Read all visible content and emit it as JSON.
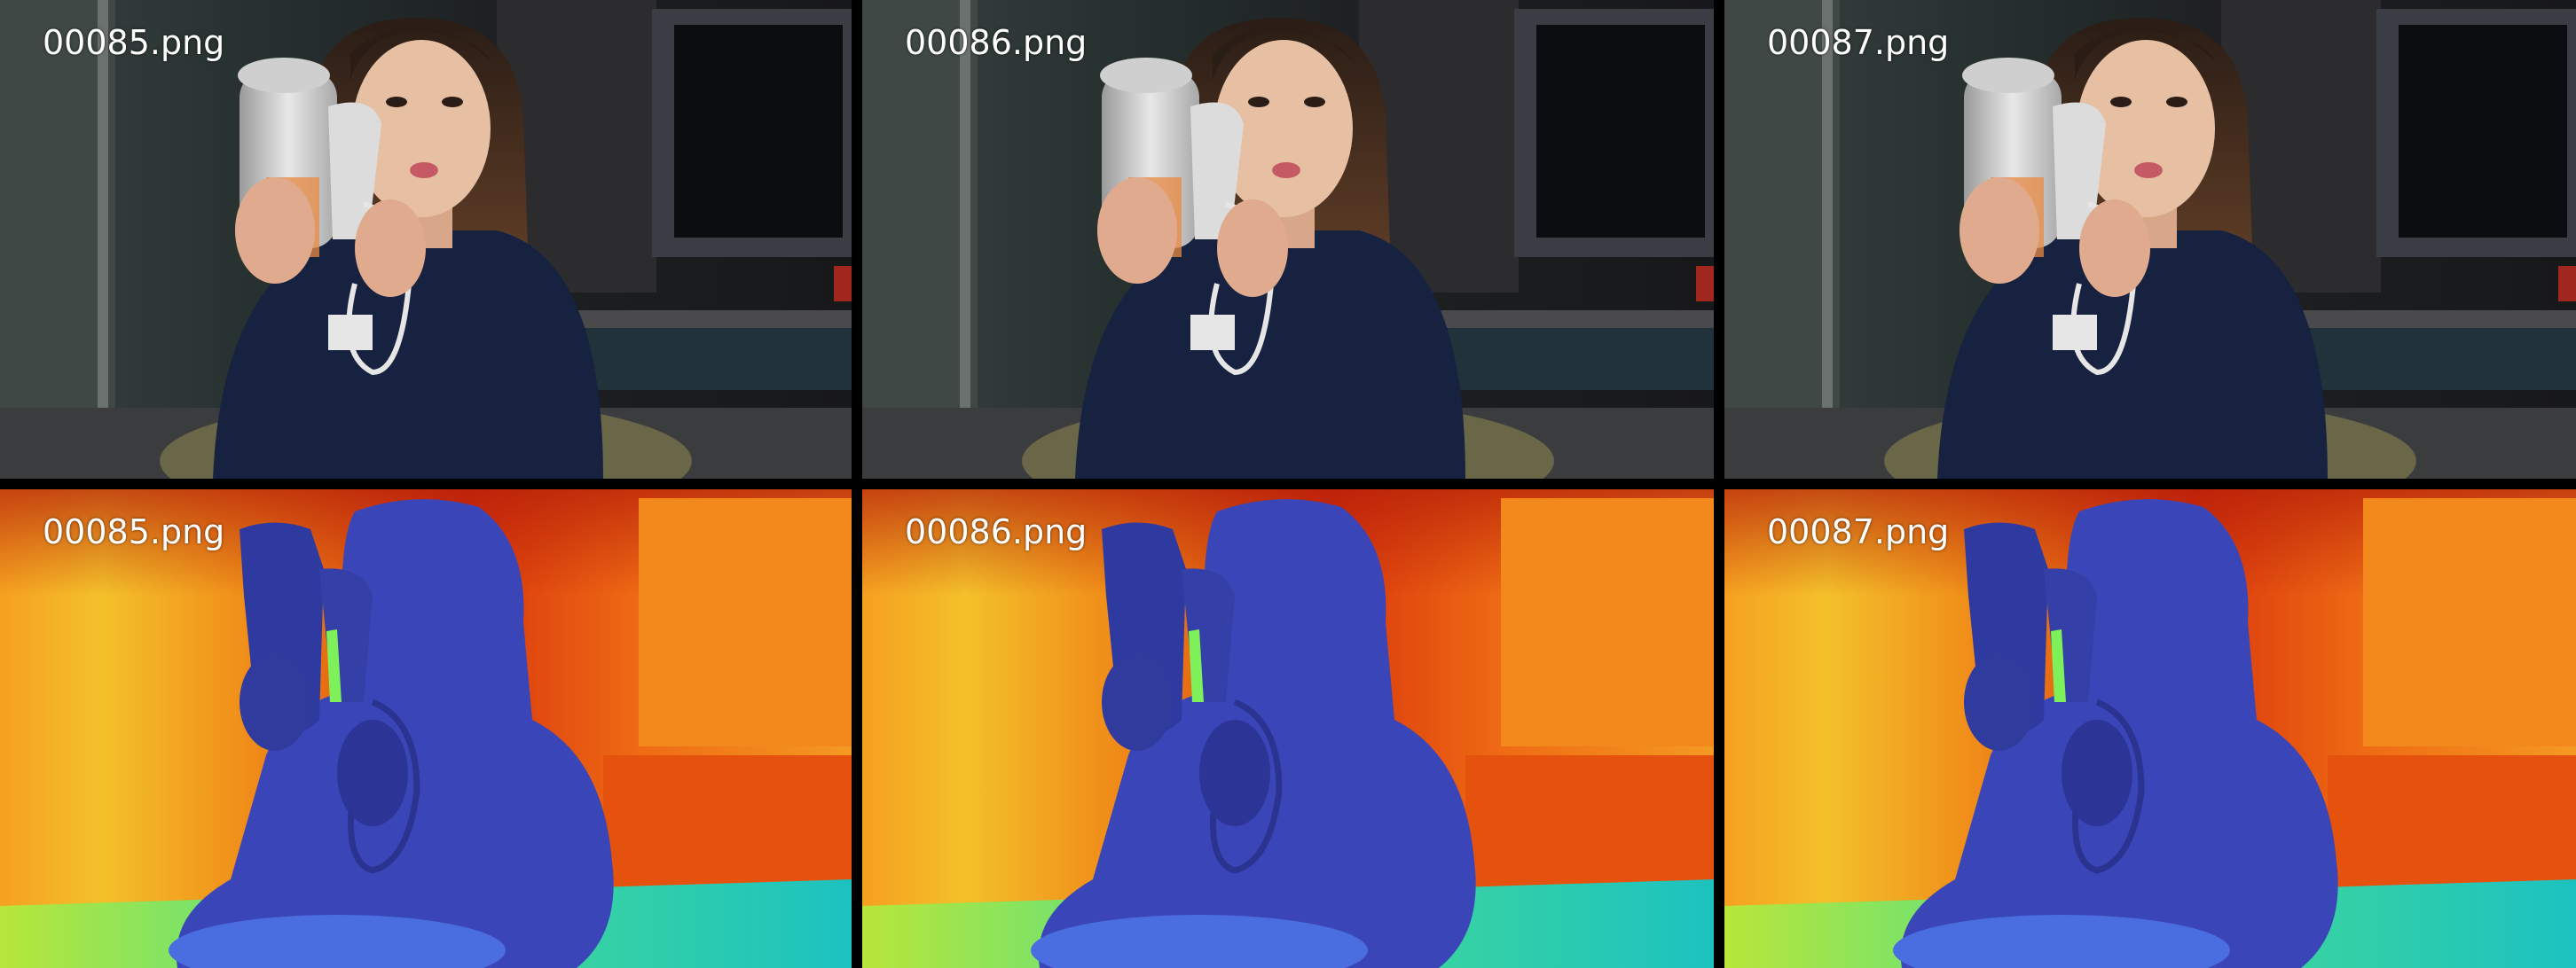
{
  "rows": [
    {
      "kind": "rgb",
      "frames": [
        {
          "filename": "00085.png"
        },
        {
          "filename": "00086.png"
        },
        {
          "filename": "00087.png"
        }
      ]
    },
    {
      "kind": "depth",
      "frames": [
        {
          "filename": "00085.png"
        },
        {
          "filename": "00086.png"
        },
        {
          "filename": "00087.png"
        }
      ]
    }
  ],
  "colors": {
    "background": "#000000",
    "label": "#ffffff",
    "depth_near": "#3a46b8",
    "depth_mid": "#22d0a0",
    "depth_far": "#e0400e",
    "depth_wall": "#f49a22"
  }
}
